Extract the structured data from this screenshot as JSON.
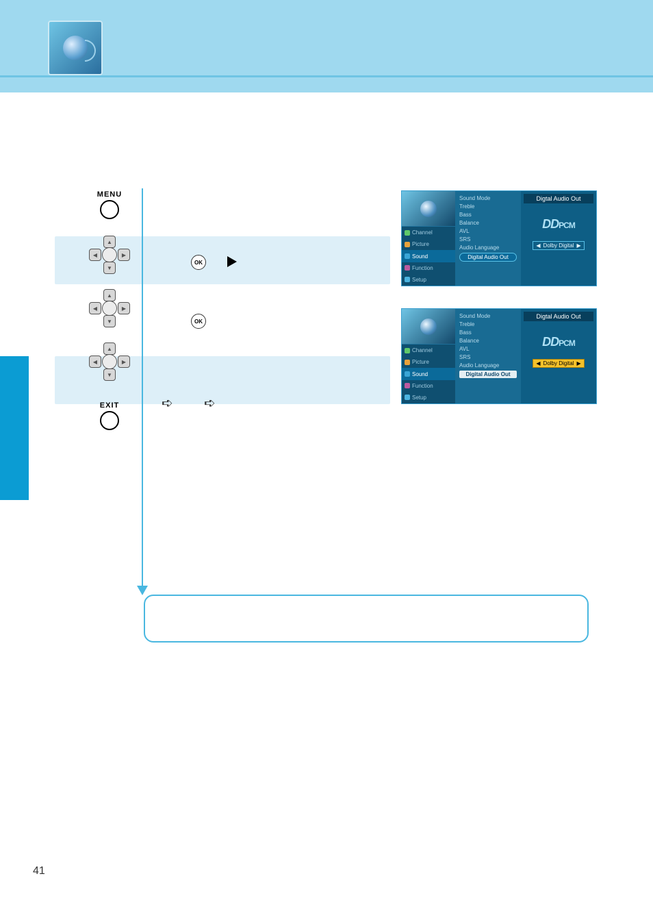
{
  "page_number": "41",
  "remote": {
    "menu_label": "MENU",
    "exit_label": "EXIT",
    "ok_label": "OK"
  },
  "osd": {
    "panel_title": "Digtal Audio Out",
    "logo_d": "D",
    "logo_pcm": "PCM",
    "option_dolby": "Dolby Digital",
    "nav": {
      "channel": "Channel",
      "picture": "Picture",
      "sound": "Sound",
      "function": "Function",
      "setup": "Setup"
    },
    "menu": {
      "sound_mode": "Sound Mode",
      "treble": "Treble",
      "bass": "Bass",
      "balance": "Balance",
      "avl": "AVL",
      "srs": "SRS",
      "audio_language": "Audio Language",
      "digital_audio_out": "Digital Audio Out"
    }
  }
}
